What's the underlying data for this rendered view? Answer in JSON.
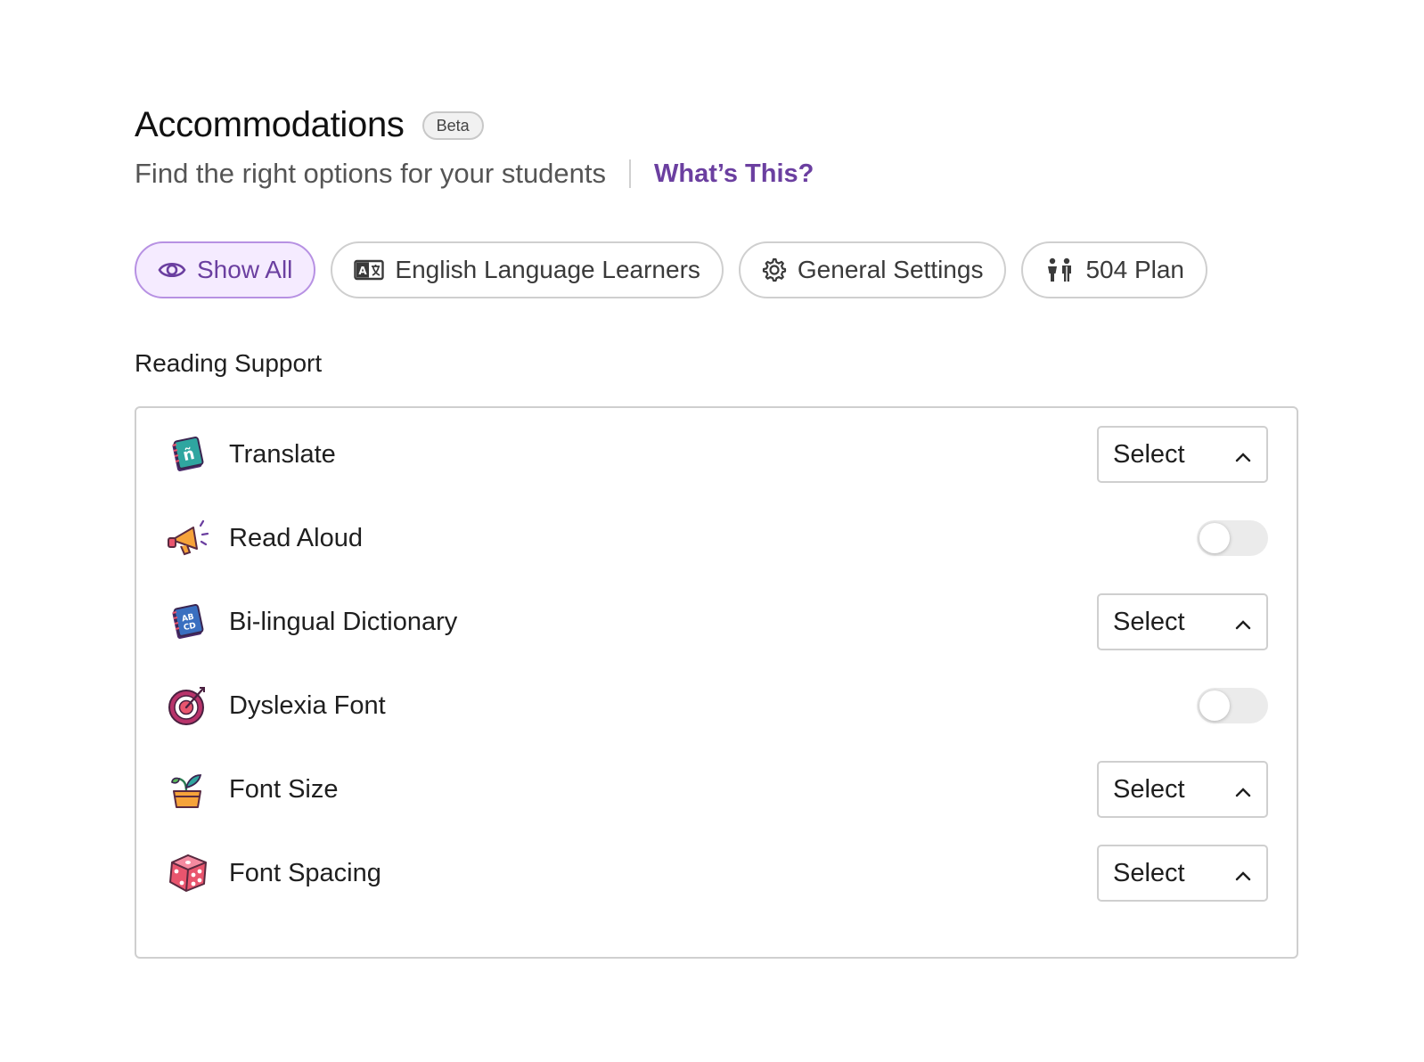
{
  "header": {
    "title": "Accommodations",
    "badge": "Beta",
    "subtitle": "Find the right options for your students",
    "help_link": "What’s This?"
  },
  "filters": [
    {
      "label": "Show All",
      "icon": "eye-icon",
      "active": true
    },
    {
      "label": "English Language Learners",
      "icon": "translate-card-icon",
      "active": false
    },
    {
      "label": "General Settings",
      "icon": "gear-icon",
      "active": false
    },
    {
      "label": "504 Plan",
      "icon": "people-icon",
      "active": false
    }
  ],
  "section": {
    "title": "Reading Support",
    "items": [
      {
        "label": "Translate",
        "icon": "translate-book-icon",
        "control": "select",
        "value": "Select"
      },
      {
        "label": "Read Aloud",
        "icon": "megaphone-icon",
        "control": "toggle",
        "on": false
      },
      {
        "label": "Bi-lingual Dictionary",
        "icon": "dictionary-book-icon",
        "control": "select",
        "value": "Select"
      },
      {
        "label": "Dyslexia Font",
        "icon": "target-icon",
        "control": "toggle",
        "on": false
      },
      {
        "label": "Font Size",
        "icon": "plant-pot-icon",
        "control": "select",
        "value": "Select"
      },
      {
        "label": "Font Spacing",
        "icon": "dice-icon",
        "control": "select",
        "value": "Select"
      }
    ]
  },
  "colors": {
    "accent": "#6b3fa0",
    "active_chip_bg": "#f5ebff",
    "border": "#cfcfcf"
  }
}
